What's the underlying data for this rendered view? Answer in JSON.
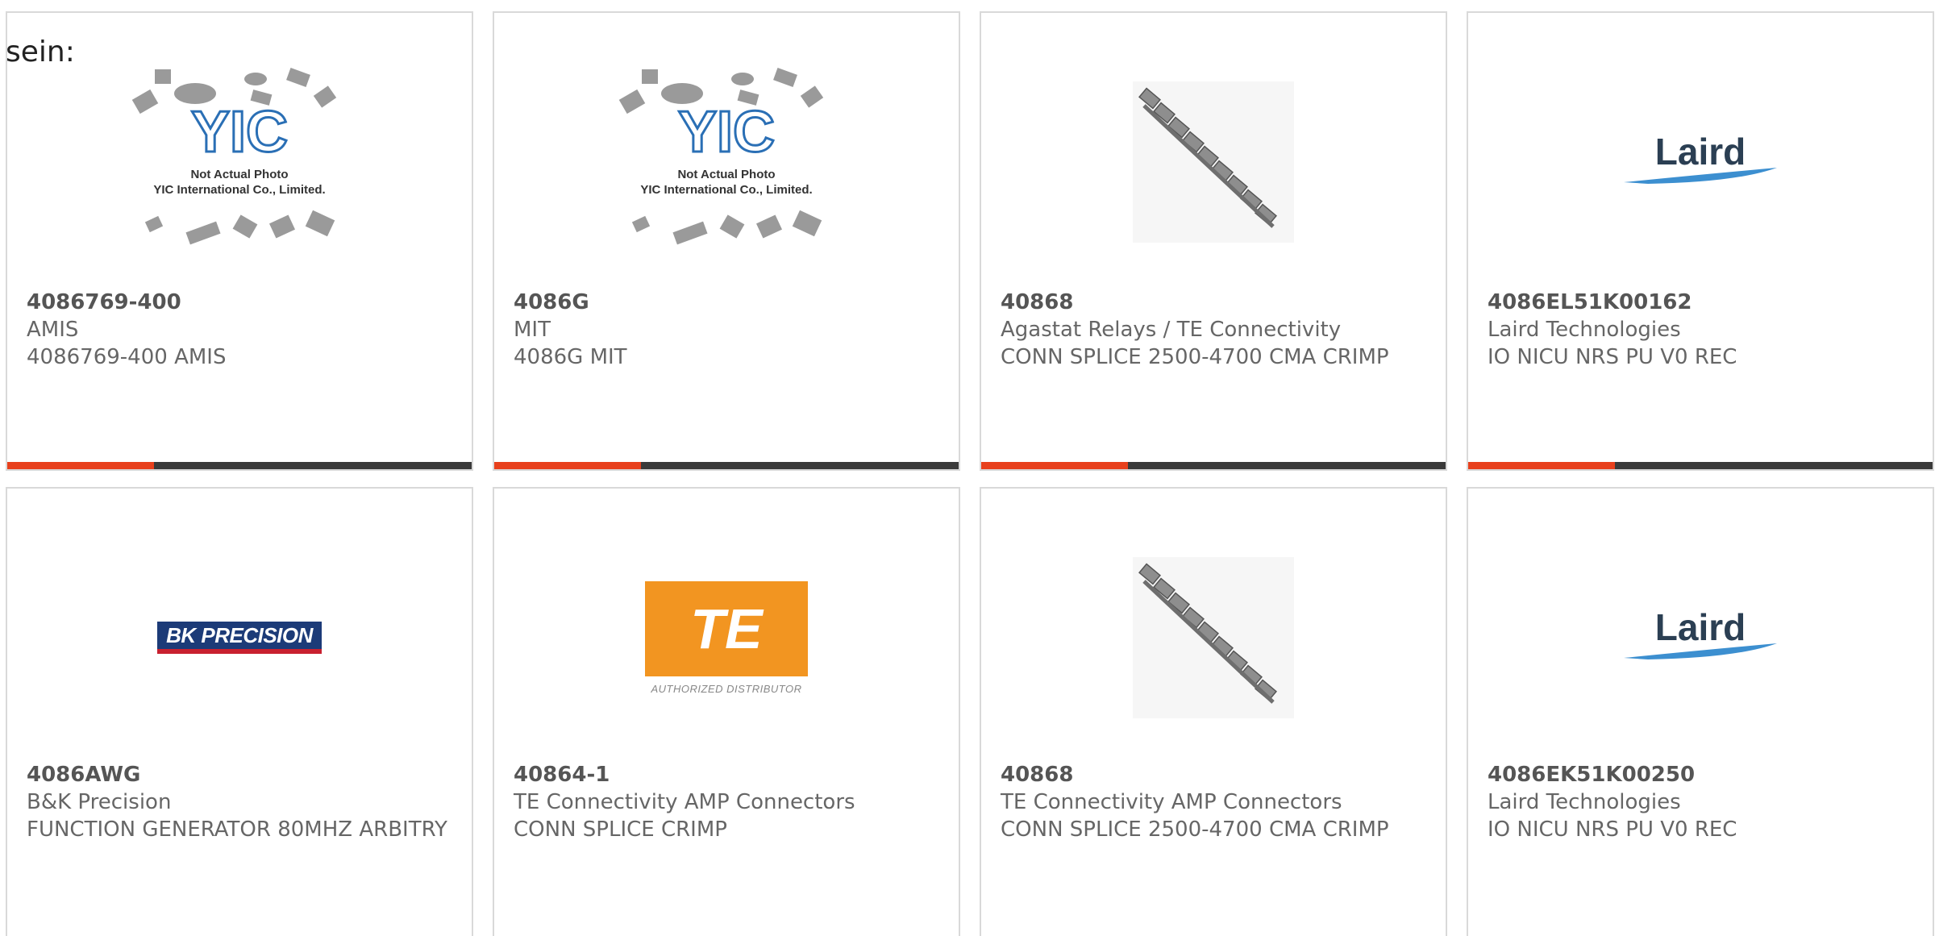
{
  "lead_text": "sein:",
  "colors": {
    "accent": "#e8401c",
    "bar": "#3a3a3a",
    "te_orange": "#f29521",
    "bk_blue": "#1c3b78",
    "bk_red": "#c8202f"
  },
  "products": [
    {
      "part_number": "4086769-400",
      "manufacturer": "AMIS",
      "description": "4086769-400 AMIS",
      "image": "yic-placeholder-icon"
    },
    {
      "part_number": "4086G",
      "manufacturer": "MIT",
      "description": "4086G MIT",
      "image": "yic-placeholder-icon"
    },
    {
      "part_number": "40868",
      "manufacturer": "Agastat Relays / TE Connectivity",
      "description": "CONN SPLICE 2500-4700 CMA CRIMP",
      "image": "splice-strip-icon"
    },
    {
      "part_number": "4086EL51K00162",
      "manufacturer": "Laird Technologies",
      "description": "IO NICU NRS PU V0 REC",
      "image": "laird-logo"
    },
    {
      "part_number": "4086AWG",
      "manufacturer": "B&K Precision",
      "description": "FUNCTION GENERATOR 80MHZ ARBITRY",
      "image": "bk-precision-logo"
    },
    {
      "part_number": "40864-1",
      "manufacturer": "TE Connectivity AMP Connectors",
      "description": "CONN SPLICE CRIMP",
      "image": "te-logo"
    },
    {
      "part_number": "40868",
      "manufacturer": "TE Connectivity AMP Connectors",
      "description": "CONN SPLICE 2500-4700 CMA CRIMP",
      "image": "splice-strip-icon"
    },
    {
      "part_number": "4086EK51K00250",
      "manufacturer": "Laird Technologies",
      "description": "IO NICU NRS PU V0 REC",
      "image": "laird-logo"
    }
  ],
  "logos": {
    "yic_caption_1": "Not Actual Photo",
    "yic_caption_2": "YIC International Co., Limited.",
    "yic_mark": "YIC",
    "laird": "Laird",
    "bk": "BK PRECISION",
    "te": "TE",
    "te_sub": "AUTHORIZED DISTRIBUTOR"
  }
}
